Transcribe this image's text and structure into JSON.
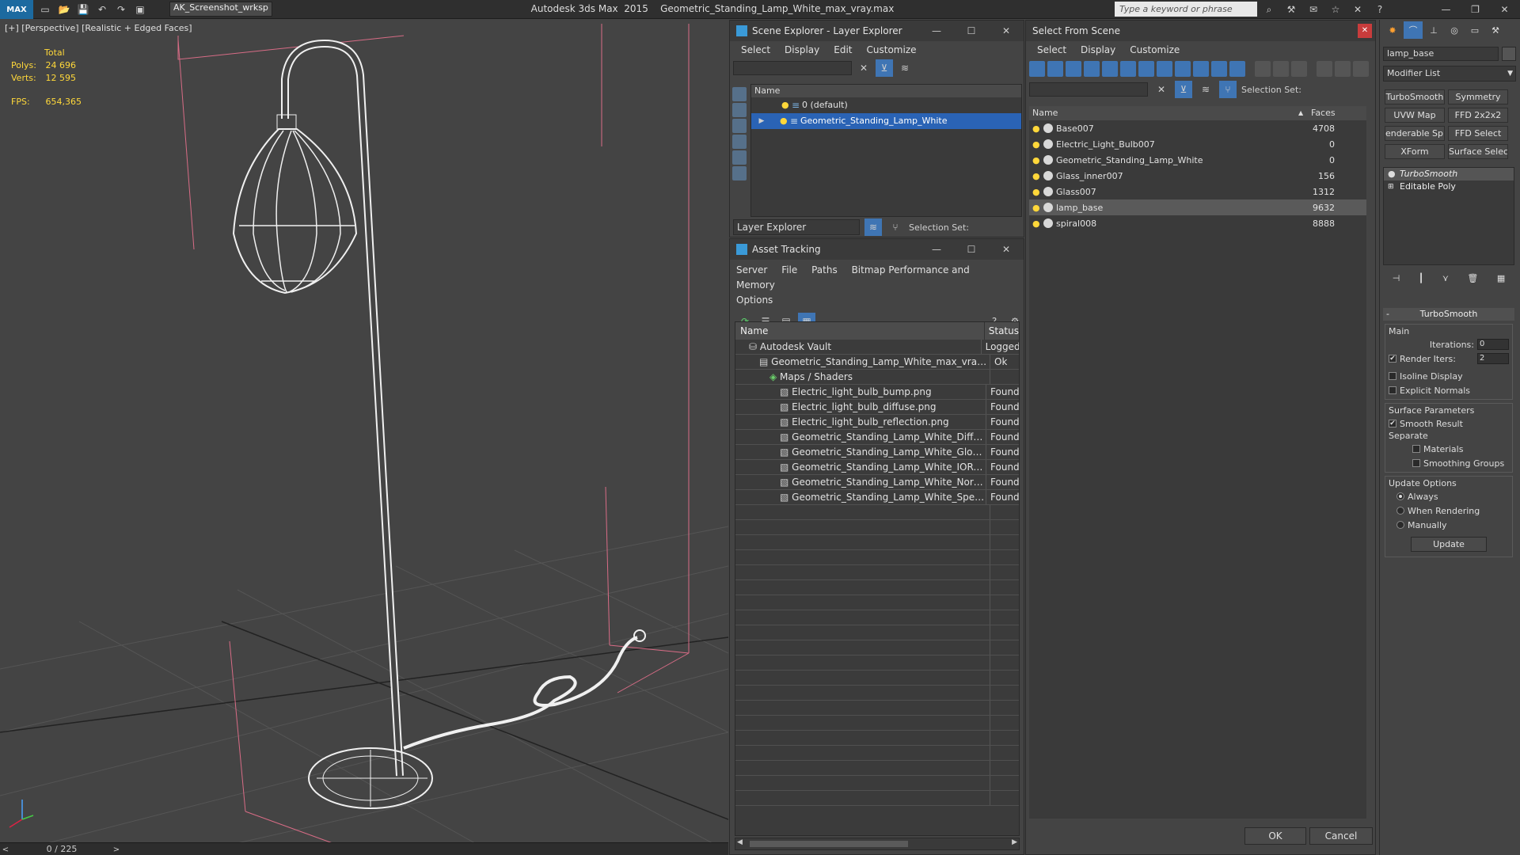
{
  "app": {
    "logo": "MAX",
    "workspace": "AK_Screenshot_wrksp",
    "title": "Autodesk 3ds Max  2015    Geometric_Standing_Lamp_White_max_vray.max",
    "search_placeholder": "Type a keyword or phrase"
  },
  "viewport": {
    "label": "[+] [Perspective] [Realistic + Edged Faces]",
    "stats_total": "Total",
    "polys_label": "Polys:",
    "polys_value": "24 696",
    "verts_label": "Verts:",
    "verts_value": "12 595",
    "fps_label": "FPS:",
    "fps_value": "654,365"
  },
  "timeline": {
    "value": "0 / 225",
    "prev": "<",
    "next": ">"
  },
  "scene_explorer": {
    "title": "Scene Explorer - Layer Explorer",
    "menu": [
      "Select",
      "Display",
      "Edit",
      "Customize"
    ],
    "column_name": "Name",
    "rows": [
      {
        "name": "0 (default)"
      },
      {
        "name": "Geometric_Standing_Lamp_White"
      }
    ],
    "layer_dropdown": "Layer Explorer",
    "selection_set_label": "Selection Set:"
  },
  "asset_tracking": {
    "title": "Asset Tracking",
    "menu": [
      "Server",
      "File",
      "Paths",
      "Bitmap Performance and Memory",
      "Options"
    ],
    "col_name": "Name",
    "col_status": "Status",
    "rows": [
      {
        "name": "Autodesk Vault",
        "status": "Logged",
        "indent": 1
      },
      {
        "name": "Geometric_Standing_Lamp_White_max_vray.max",
        "status": "Ok",
        "indent": 2
      },
      {
        "name": "Maps / Shaders",
        "status": "",
        "indent": 3
      },
      {
        "name": "Electric_light_bulb_bump.png",
        "status": "Found",
        "indent": 4
      },
      {
        "name": "Electric_light_bulb_diffuse.png",
        "status": "Found",
        "indent": 4
      },
      {
        "name": "Electric_light_bulb_reflection.png",
        "status": "Found",
        "indent": 4
      },
      {
        "name": "Geometric_Standing_Lamp_White_Diffuse....",
        "status": "Found",
        "indent": 4
      },
      {
        "name": "Geometric_Standing_Lamp_White_Glossin...",
        "status": "Found",
        "indent": 4
      },
      {
        "name": "Geometric_Standing_Lamp_White_IOR.png",
        "status": "Found",
        "indent": 4
      },
      {
        "name": "Geometric_Standing_Lamp_White_Normal...",
        "status": "Found",
        "indent": 4
      },
      {
        "name": "Geometric_Standing_Lamp_White_Specul...",
        "status": "Found",
        "indent": 4
      }
    ]
  },
  "select_from_scene": {
    "title": "Select From Scene",
    "menu": [
      "Select",
      "Display",
      "Customize"
    ],
    "selection_set_label": "Selection Set:",
    "col_name": "Name",
    "col_faces": "Faces",
    "rows": [
      {
        "name": "Base007",
        "faces": "4708"
      },
      {
        "name": "Electric_Light_Bulb007",
        "faces": "0"
      },
      {
        "name": "Geometric_Standing_Lamp_White",
        "faces": "0"
      },
      {
        "name": "Glass_inner007",
        "faces": "156"
      },
      {
        "name": "Glass007",
        "faces": "1312"
      },
      {
        "name": "lamp_base",
        "faces": "9632"
      },
      {
        "name": "spiral008",
        "faces": "8888"
      }
    ],
    "ok": "OK",
    "cancel": "Cancel"
  },
  "command_panel": {
    "object_name": "lamp_base",
    "modifier_list": "Modifier List",
    "buttons": [
      "TurboSmooth",
      "Symmetry",
      "UVW Map",
      "FFD 2x2x2",
      "enderable Splir",
      "FFD Select",
      "XForm",
      "Surface Select"
    ],
    "stack": [
      "TurboSmooth",
      "Editable Poly"
    ],
    "rollout_title": "TurboSmooth",
    "main_label": "Main",
    "iterations_label": "Iterations:",
    "iterations_value": "0",
    "render_iters_label": "Render Iters:",
    "render_iters_value": "2",
    "isoline_label": "Isoline Display",
    "explicit_normals_label": "Explicit Normals",
    "surface_params_label": "Surface Parameters",
    "smooth_result_label": "Smooth Result",
    "separate_label": "Separate",
    "materials_label": "Materials",
    "smoothing_groups_label": "Smoothing Groups",
    "update_options_label": "Update Options",
    "always_label": "Always",
    "when_rendering_label": "When Rendering",
    "manually_label": "Manually",
    "update_button": "Update"
  }
}
